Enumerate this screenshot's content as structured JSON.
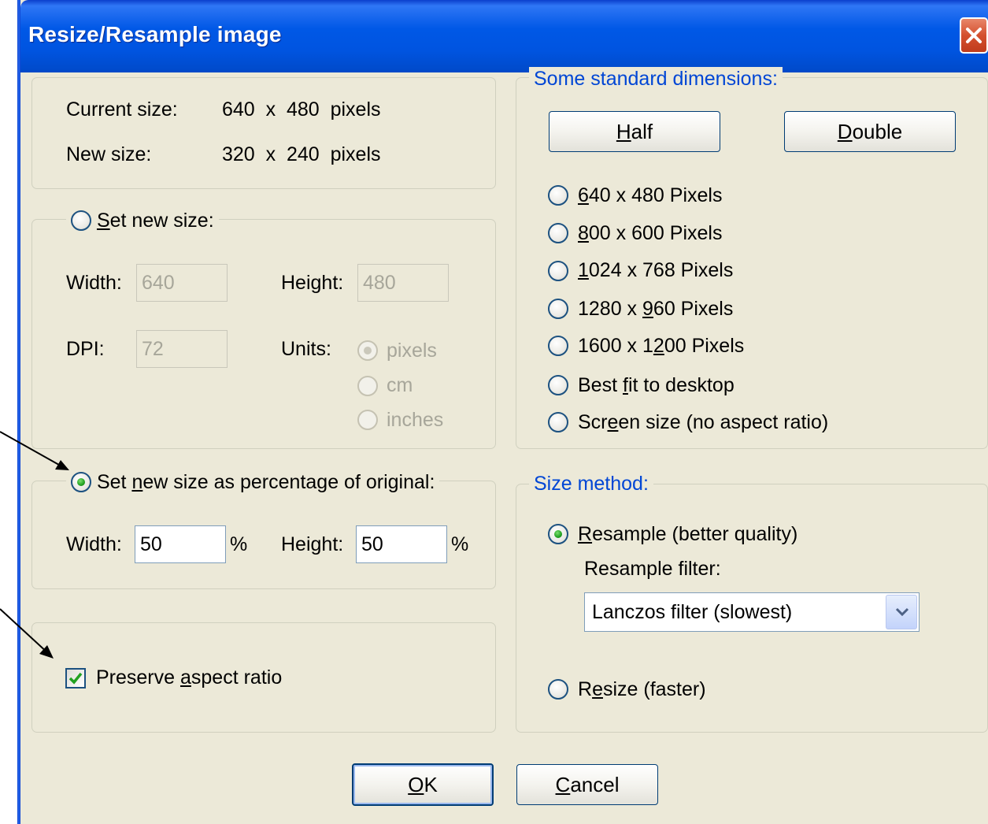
{
  "window": {
    "title": "Resize/Resample image"
  },
  "info": {
    "current_size_label": "Current size:",
    "current_size_value": "640  x  480  pixels",
    "new_size_label": "New size:",
    "new_size_value": "320  x  240  pixels"
  },
  "set_new_size": {
    "label": "Set new size:",
    "label_ul": "S",
    "label_rest": "et new size:",
    "checked": false,
    "width_label": "Width:",
    "width_value": "640",
    "height_label": "Height:",
    "height_value": "480",
    "dpi_label": "DPI:",
    "dpi_value": "72",
    "units_label": "Units:",
    "units": [
      {
        "label": "pixels",
        "checked": true
      },
      {
        "label": "cm",
        "checked": false
      },
      {
        "label": "inches",
        "checked": false
      }
    ]
  },
  "percentage": {
    "label": "Set new size as percentage of original:",
    "label_pre": "Set ",
    "label_ul": "n",
    "label_post": "ew size as percentage of original:",
    "checked": true,
    "width_label": "Width:",
    "width_value": "50",
    "width_unit": "%",
    "height_label": "Height:",
    "height_value": "50",
    "height_unit": "%"
  },
  "aspect": {
    "label": "Preserve aspect ratio",
    "label_pre": "Preserve ",
    "label_ul": "a",
    "label_post": "spect ratio",
    "checked": true
  },
  "standard": {
    "title": "Some standard dimensions:",
    "half_label": "Half",
    "half_ul": "H",
    "half_rest": "alf",
    "double_label": "Double",
    "double_ul": "D",
    "double_rest": "ouble",
    "options": [
      {
        "label": "640 x 480 Pixels",
        "pre": "",
        "ul": "6",
        "post": "40 x 480 Pixels"
      },
      {
        "label": "800 x 600 Pixels",
        "pre": "",
        "ul": "8",
        "post": "00 x 600 Pixels"
      },
      {
        "label": "1024 x 768 Pixels",
        "pre": "",
        "ul": "1",
        "post": "024 x 768 Pixels"
      },
      {
        "label": "1280 x 960 Pixels",
        "pre": "1280 x ",
        "ul": "9",
        "post": "60 Pixels"
      },
      {
        "label": "1600 x 1200 Pixels",
        "pre": "1600 x 1",
        "ul": "2",
        "post": "00 Pixels"
      },
      {
        "label": "Best fit to desktop",
        "pre": "Best ",
        "ul": "f",
        "post": "it to desktop"
      },
      {
        "label": "Screen size (no aspect ratio)",
        "pre": "Scr",
        "ul": "e",
        "post": "en size (no aspect ratio)"
      }
    ]
  },
  "method": {
    "title": "Size method:",
    "resample_label": "Resample (better quality)",
    "resample_ul": "R",
    "resample_rest": "esample (better quality)",
    "resample_checked": true,
    "filter_label": "Resample filter:",
    "filter_value": "Lanczos filter (slowest)",
    "resize_label": "Resize (faster)",
    "resize_pre": "R",
    "resize_ul": "e",
    "resize_post": "size (faster)",
    "resize_checked": false
  },
  "buttons": {
    "ok_label": "OK",
    "ok_ul": "O",
    "ok_rest": "K",
    "cancel_label": "Cancel",
    "cancel_ul": "C",
    "cancel_rest": "ancel"
  },
  "colors": {
    "title_bar": "#0054e0",
    "dialog_bg": "#ece9d8",
    "group_title_blue": "#0046d5",
    "radio_dot_green": "#21a121",
    "close_red": "#d4502e"
  }
}
